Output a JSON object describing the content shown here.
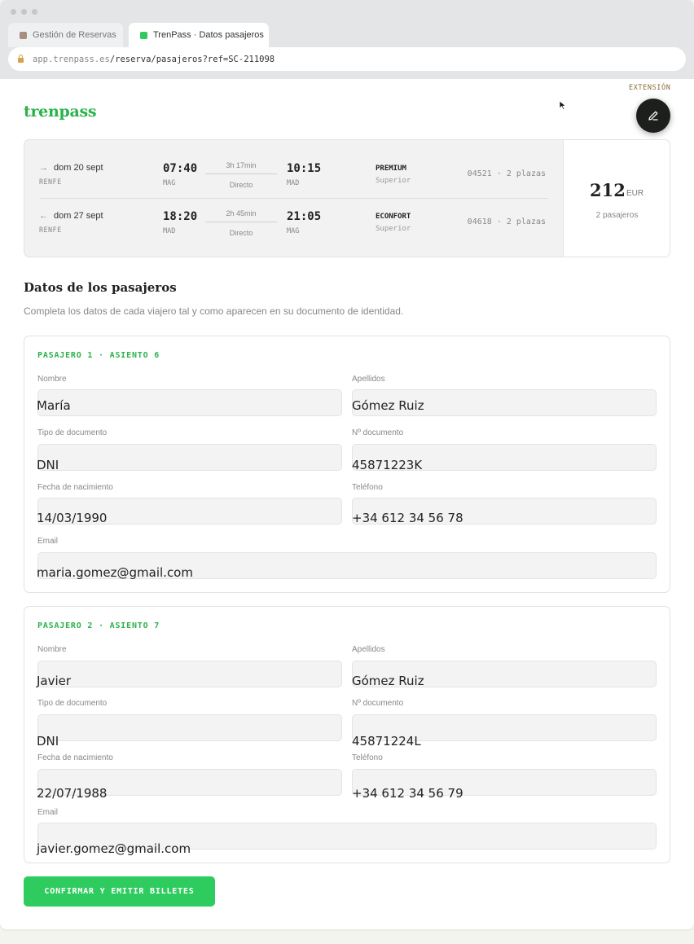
{
  "browser": {
    "tabs": [
      {
        "label": "Gestión de Reservas",
        "favicon_color": "#a88e7e"
      },
      {
        "label": "TrenPass · Datos pasajeros",
        "favicon_color": "#2ecc5f"
      }
    ],
    "url_host": "app.trenpass.es",
    "url_path": "/reserva/pasajeros?ref=SC-211098"
  },
  "brand": {
    "name": "trenpass",
    "color": "#2bb24c"
  },
  "extension": {
    "label": "EXTENSIÓN",
    "icon": "pencil-icon"
  },
  "trips": [
    {
      "direction_icon": "→",
      "date": "dom 20 sept",
      "operator": "RENFE",
      "dep_time": "07:40",
      "dep_code": "MAG",
      "duration": "3h 17min",
      "stops": "Directo",
      "arr_time": "10:15",
      "arr_code": "MAD",
      "class": "PREMIUM",
      "class_sub": "Superior",
      "train": "04521 · 2 plazas"
    },
    {
      "direction_icon": "←",
      "date": "dom 27 sept",
      "operator": "RENFE",
      "dep_time": "18:20",
      "dep_code": "MAD",
      "duration": "2h 45min",
      "stops": "Directo",
      "arr_time": "21:05",
      "arr_code": "MAG",
      "class": "ECONFORT",
      "class_sub": "Superior",
      "train": "04618 · 2 plazas"
    }
  ],
  "price": {
    "amount": "212",
    "currency": "EUR",
    "passengers": "2 pasajeros"
  },
  "section": {
    "title": "Datos de los pasajeros",
    "subtitle": "Completa los datos de cada viajero tal y como aparecen en su documento de identidad."
  },
  "labels": {
    "nombre": "Nombre",
    "apellidos": "Apellidos",
    "tipo_documento": "Tipo de documento",
    "num_documento": "Nº documento",
    "fecha_nacimiento": "Fecha de nacimiento",
    "telefono": "Teléfono",
    "email": "Email"
  },
  "passengers": [
    {
      "title": "PASAJERO 1 · ASIENTO 6",
      "nombre": "María",
      "apellidos": "Gómez Ruiz",
      "tipo_documento": "DNI",
      "num_documento": "45871223K",
      "fecha_nacimiento": "14/03/1990",
      "telefono": "+34 612 34 56 78",
      "email": "maria.gomez@gmail.com"
    },
    {
      "title": "PASAJERO 2 · ASIENTO 7",
      "nombre": "Javier",
      "apellidos": "Gómez Ruiz",
      "tipo_documento": "DNI",
      "num_documento": "45871224L",
      "fecha_nacimiento": "22/07/1988",
      "telefono": "+34 612 34 56 79",
      "email": "javier.gomez@gmail.com"
    }
  ],
  "confirm_button": "CONFIRMAR Y EMITIR BILLETES"
}
